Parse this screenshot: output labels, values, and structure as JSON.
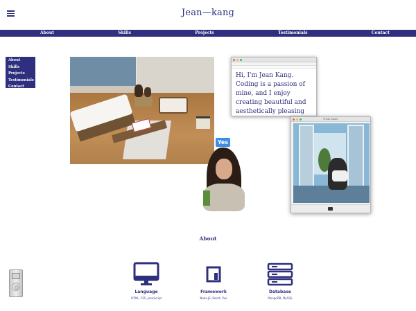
{
  "header": {
    "title": "Jean—kang",
    "menu_icon": "hamburger-icon"
  },
  "navbar": {
    "items": [
      "About",
      "Skills",
      "Projects",
      "Testimonials",
      "Contact"
    ]
  },
  "side_menu": {
    "items": [
      "About",
      "Skills",
      "Projects",
      "Testimonials",
      "Contact"
    ]
  },
  "intro_note": {
    "text": "Hi, I'm Jean Kang. Coding is a passion of mine, and I enjoy creating beautiful and aesthetically pleasing interfaces."
  },
  "photo_window": {
    "title": "Photo Booth"
  },
  "selfie": {
    "badge": "Yes"
  },
  "about": {
    "title": "About",
    "features": [
      {
        "icon": "monitor-icon",
        "name": "Language",
        "desc": "HTML, CSS, JavaScript"
      },
      {
        "icon": "framework-icon",
        "name": "Framework",
        "desc": "Node.JS, React, Vue"
      },
      {
        "icon": "server-icon",
        "name": "Database",
        "desc": "MongoDB, MySQL"
      }
    ]
  },
  "colors": {
    "brand": "#2e2f7e",
    "badge": "#3d8ee6",
    "background": "#ffffff"
  }
}
